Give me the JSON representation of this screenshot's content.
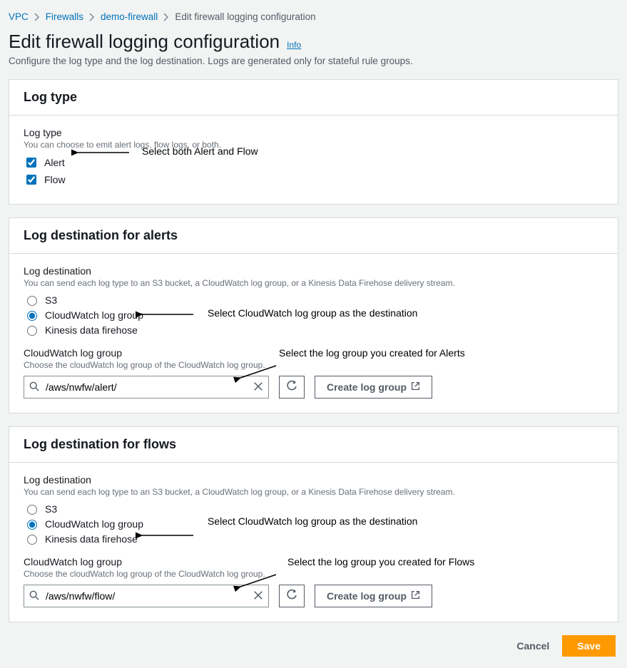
{
  "breadcrumbs": [
    "VPC",
    "Firewalls",
    "demo-firewall",
    "Edit firewall logging configuration"
  ],
  "page_title": "Edit firewall logging configuration",
  "info_label": "Info",
  "page_subtitle": "Configure the log type and the log destination. Logs are generated only for stateful rule groups.",
  "log_type_panel": {
    "header": "Log type",
    "label": "Log type",
    "desc": "You can choose to emit alert logs, flow logs, or both.",
    "options": {
      "alert_label": "Alert",
      "flow_label": "Flow"
    },
    "annot": "Select both Alert and Flow"
  },
  "alerts_panel": {
    "header": "Log destination for alerts",
    "dest_label": "Log destination",
    "dest_desc": "You can send each log type to an S3 bucket, a CloudWatch log group, or a Kinesis Data Firehose delivery stream.",
    "radios": {
      "s3": "S3",
      "cw": "CloudWatch log group",
      "kdf": "Kinesis data firehose"
    },
    "dest_annot": "Select CloudWatch  log group as the destination",
    "cw_label": "CloudWatch log group",
    "cw_desc": "Choose the cloudWatch log group of the CloudWatch log group.",
    "search_value": "/aws/nwfw/alert/",
    "create_btn": "Create log group",
    "cw_annot": "Select the log group you created for Alerts"
  },
  "flows_panel": {
    "header": "Log destination for flows",
    "dest_label": "Log destination",
    "dest_desc": "You can send each log type to an S3 bucket, a CloudWatch log group, or a Kinesis Data Firehose delivery stream.",
    "radios": {
      "s3": "S3",
      "cw": "CloudWatch log group",
      "kdf": "Kinesis data firehose"
    },
    "dest_annot": "Select CloudWatch  log group as the destination",
    "cw_label": "CloudWatch log group",
    "cw_desc": "Choose the cloudWatch log group of the CloudWatch log group.",
    "search_value": "/aws/nwfw/flow/",
    "create_btn": "Create log group",
    "cw_annot": "Select the log group you created for Flows"
  },
  "footer": {
    "cancel": "Cancel",
    "save": "Save"
  }
}
